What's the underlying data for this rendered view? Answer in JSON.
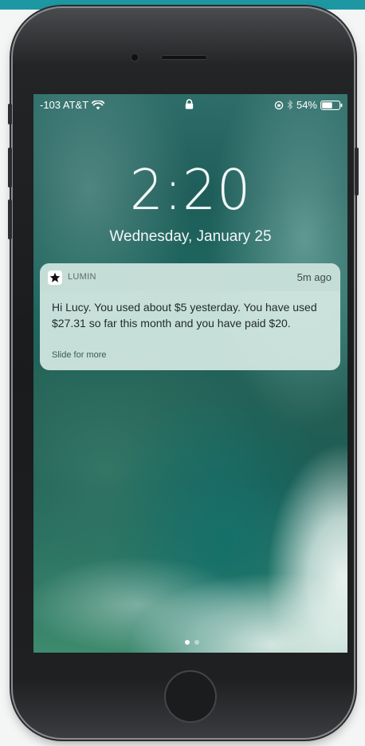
{
  "status_bar": {
    "carrier": "-103 AT&T",
    "battery": "54%",
    "icons": [
      "wifi-icon",
      "lock-icon",
      "orientation-lock-icon",
      "bluetooth-icon",
      "battery-icon"
    ]
  },
  "lock_screen": {
    "time": "2:20",
    "date": "Wednesday, January 25"
  },
  "notification": {
    "app_name": "LUMIN",
    "app_icon": "star-icon",
    "time_ago": "5m ago",
    "message": "Hi Lucy. You used about $5 yesterday. You have used $27.31 so far this month and you have paid $20.",
    "action_hint": "Slide for more"
  },
  "colors": {
    "accent_strip": "#1d98a3",
    "notification_bg": "#d6e9e4"
  }
}
